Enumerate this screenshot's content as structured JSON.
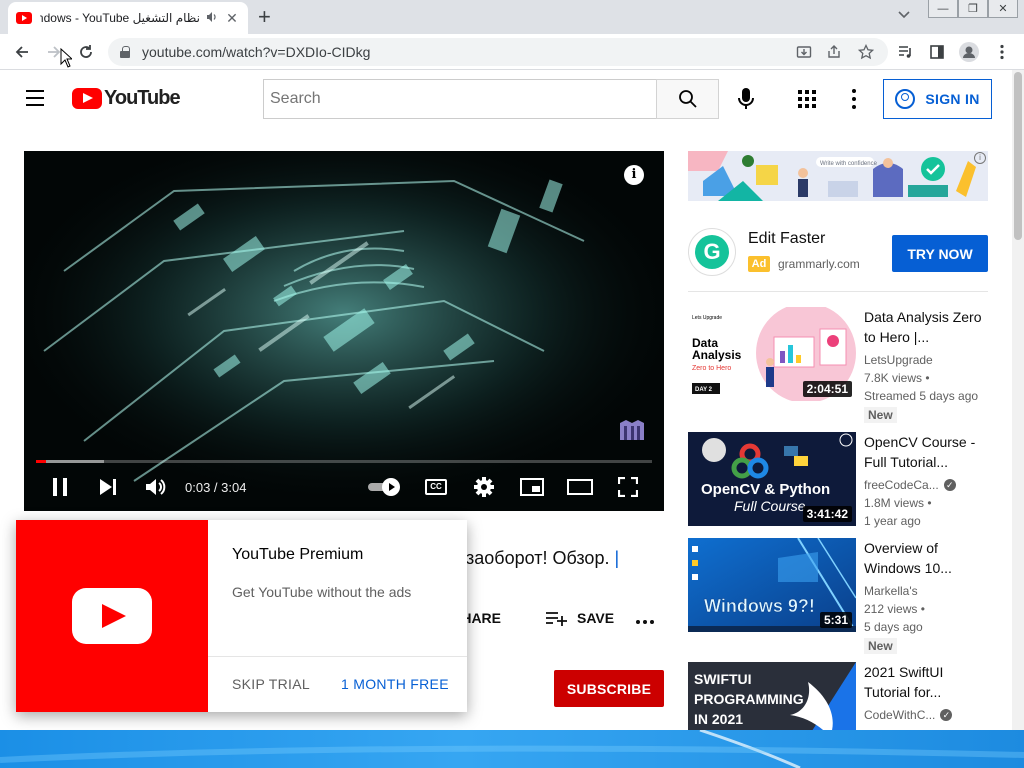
{
  "browser": {
    "tab_title": "نظام التشغيل Windows - YouTube",
    "tab_audio_icon": "speaker-icon",
    "url": "youtube.com/watch?v=DXDIo-CIDkg"
  },
  "masthead": {
    "logo_text": "YouTube",
    "search_placeholder": "Search",
    "sign_in_label": "SIGN IN"
  },
  "player": {
    "time_current": "0:03",
    "time_sep": " / ",
    "time_total": "3:04",
    "cc_label": "CC",
    "progress_played_fraction": 0.016,
    "progress_loaded_fraction": 0.11
  },
  "video": {
    "title_visible": "заоборот! Обзор. ",
    "title_hash": "|",
    "share_label": "SHARE",
    "save_label": "SAVE",
    "subscribe_label": "SUBSCRIBE"
  },
  "premium_popup": {
    "title": "YouTube Premium",
    "description": "Get YouTube without the ads",
    "skip_label": "SKIP TRIAL",
    "free_label": "1 MONTH FREE"
  },
  "ad": {
    "banner_text": "Write with confidence",
    "info_glyph": "i",
    "logo_letter": "G",
    "title": "Edit Faster",
    "tag": "Ad",
    "domain": "grammarly.com",
    "cta": "TRY NOW"
  },
  "recommendations": [
    {
      "title": "Data Analysis Zero to Hero |...",
      "channel": "LetsUpgrade",
      "verified": false,
      "views": "7.8K views •",
      "age": "Streamed 5 days ago",
      "badge": "New",
      "duration": "2:04:51",
      "thumb": {
        "brand": "Lets Upgrade",
        "heading1": "Data",
        "heading2": "Analysis",
        "sub": "Zero to Hero",
        "day": "DAY 2"
      }
    },
    {
      "title": "OpenCV Course - Full Tutorial...",
      "channel": "freeCodeCa...",
      "verified": true,
      "views": "1.8M views •",
      "age": "1 year ago",
      "badge": "",
      "duration": "3:41:42",
      "thumb": {
        "line1": "OpenCV & Python",
        "line2": "Full Course"
      }
    },
    {
      "title": "Overview of Windows 10...",
      "channel": "Markella's",
      "verified": false,
      "views": "212 views •",
      "age": "5 days ago",
      "badge": "New",
      "duration": "5:31",
      "thumb": {
        "line1": "Windows 9?!"
      }
    },
    {
      "title": "2021 SwiftUI Tutorial for...",
      "channel": "CodeWithC...",
      "verified": true,
      "views": "",
      "age": "",
      "badge": "",
      "duration": "",
      "thumb": {
        "line1": "SWIFTUI",
        "line2": "PROGRAMMING",
        "line3": "IN 2021"
      }
    }
  ],
  "colors": {
    "youtube_red": "#ff0000",
    "subscribe_red": "#cc0000",
    "link_blue": "#065fd4",
    "grammarly_green": "#15c39a",
    "ad_badge_yellow": "#fbc02d"
  }
}
